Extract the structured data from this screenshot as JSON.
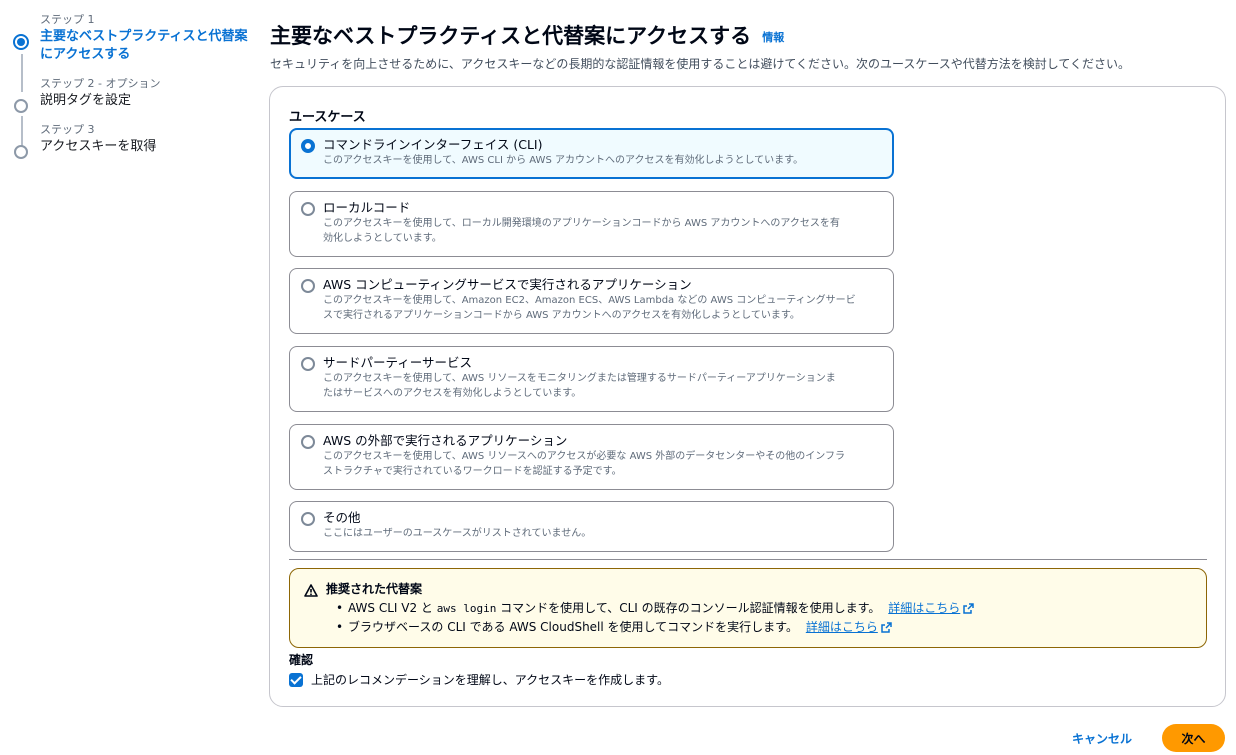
{
  "stepper": {
    "steps": [
      {
        "num": "ステップ 1",
        "title_line1": "主要なベストプラクティスと代替案",
        "title_line2": "にアクセスする"
      },
      {
        "num": "ステップ 2 - オプション",
        "title": "説明タグを設定"
      },
      {
        "num": "ステップ 3",
        "title": "アクセスキーを取得"
      }
    ]
  },
  "header": {
    "title": "主要なベストプラクティスと代替案にアクセスする",
    "info": "情報",
    "description": "セキュリティを向上させるために、アクセスキーなどの長期的な認証情報を使用することは避けてください。次のユースケースや代替方法を検討してください。"
  },
  "use_case": {
    "label": "ユースケース",
    "options": [
      {
        "label": "コマンドラインインターフェイス (CLI)",
        "desc1": "このアクセスキーを使用して、AWS CLI から AWS アカウントへのアクセスを有効化しようとしています。",
        "desc2": ""
      },
      {
        "label": "ローカルコード",
        "desc1": "このアクセスキーを使用して、ローカル開発環境のアプリケーションコードから AWS アカウントへのアクセスを有",
        "desc2": "効化しようとしています。"
      },
      {
        "label": "AWS コンピューティングサービスで実行されるアプリケーション",
        "desc1": "このアクセスキーを使用して、Amazon EC2、Amazon ECS、AWS Lambda などの AWS コンピューティングサービ",
        "desc2": "スで実行されるアプリケーションコードから AWS アカウントへのアクセスを有効化しようとしています。"
      },
      {
        "label": "サードパーティーサービス",
        "desc1": "このアクセスキーを使用して、AWS リソースをモニタリングまたは管理するサードパーティーアプリケーションま",
        "desc2": "たはサービスへのアクセスを有効化しようとしています。"
      },
      {
        "label": "AWS の外部で実行されるアプリケーション",
        "desc1": "このアクセスキーを使用して、AWS リソースへのアクセスが必要な AWS 外部のデータセンターやその他のインフラ",
        "desc2": "ストラクチャで実行されているワークロードを認証する予定です。"
      },
      {
        "label": "その他",
        "desc1": "ここにはユーザーのユースケースがリストされていません。",
        "desc2": ""
      }
    ],
    "selected_index": 0
  },
  "alert": {
    "title": "推奨された代替案",
    "item1_pre": "AWS CLI V2 と ",
    "item1_code": "aws login",
    "item1_post": " コマンドを使用して、CLI の既存のコンソール認証情報を使用します。",
    "item2_text": "ブラウザベースの CLI である AWS CloudShell を使用してコマンドを実行します。",
    "learn_more": "詳細はこちら"
  },
  "confirmation": {
    "label": "確認",
    "checkbox_text": "上記のレコメンデーションを理解し、アクセスキーを作成します。",
    "checked": true
  },
  "footer": {
    "cancel": "キャンセル",
    "next": "次へ"
  },
  "colors": {
    "accent": "#0972d3",
    "primary_button": "#ff9900",
    "warning_border": "#8d6605",
    "warning_bg": "#fffce9"
  }
}
